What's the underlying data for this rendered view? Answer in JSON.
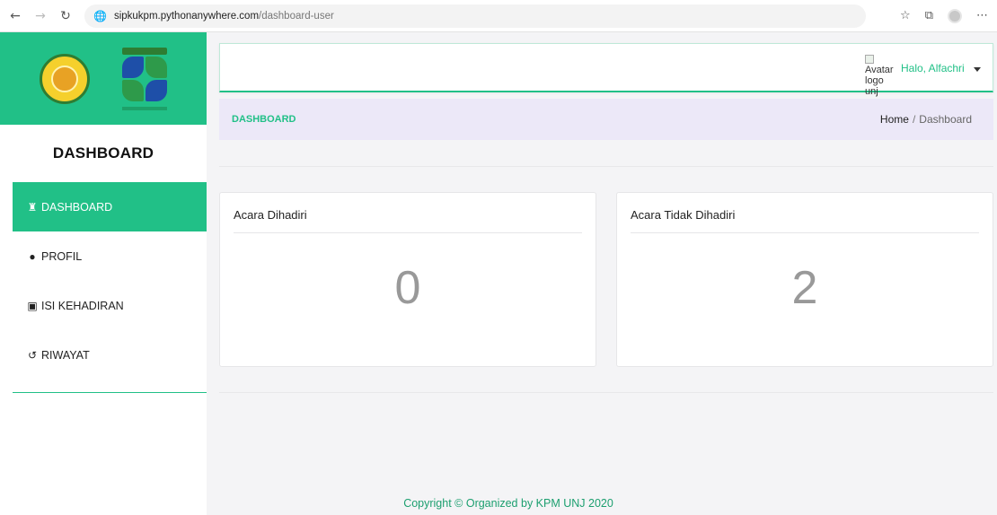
{
  "browser": {
    "url_host": "sipkukpm.pythonanywhere.com",
    "url_path": "/dashboard-user"
  },
  "sidebar": {
    "title": "DASHBOARD",
    "items": [
      {
        "label": "DASHBOARD",
        "icon": "home-icon",
        "active": true
      },
      {
        "label": "PROFIL",
        "icon": "user-icon",
        "active": false
      },
      {
        "label": "ISI KEHADIRAN",
        "icon": "book-icon",
        "active": false
      },
      {
        "label": "RIWAYAT",
        "icon": "history-icon",
        "active": false
      }
    ]
  },
  "topbar": {
    "avatar_alt": "Avatar logo unj",
    "greeting": "Halo, Alfachri"
  },
  "breadcrumb": {
    "title": "DASHBOARD",
    "home": "Home",
    "separator": "/",
    "current": "Dashboard"
  },
  "cards": [
    {
      "title": "Acara Dihadiri",
      "value": "0"
    },
    {
      "title": "Acara Tidak Dihadiri",
      "value": "2"
    }
  ],
  "footer": "Copyright © Organized by KPM UNJ 2020",
  "colors": {
    "accent": "#21c087",
    "breadcrumb_bg": "#ece8f8"
  }
}
